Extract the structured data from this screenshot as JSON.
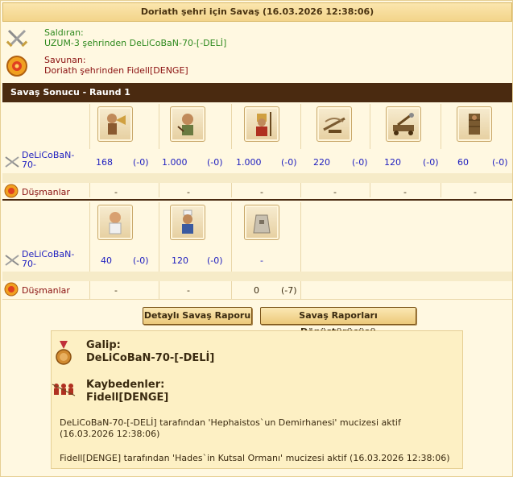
{
  "header": {
    "title": "Doriath şehri için Savaş (16.03.2026 12:38:06)"
  },
  "attacker": {
    "label": "Saldıran:",
    "value": "UZUM-3 şehrinden DeLiCoBaN-70-[-DELİ]",
    "icon": "crossed-swords-icon"
  },
  "defender": {
    "label": "Savunan:",
    "value": "Doriath şehrinden Fidell[DENGE]",
    "icon": "shield-icon"
  },
  "round_title": "Savaş Sonucu - Raund 1",
  "section1": {
    "attacker_name": "DeLiCoBaN-70-",
    "enemies_label": "Düşmanlar",
    "units": [
      {
        "icon": "trumpeter-icon",
        "count": "168",
        "delta": "(-0)",
        "enemy": "-",
        "enemy_delta": ""
      },
      {
        "icon": "slinger-icon",
        "count": "1.000",
        "delta": "(-0)",
        "enemy": "-",
        "enemy_delta": ""
      },
      {
        "icon": "hoplite-icon",
        "count": "1.000",
        "delta": "(-0)",
        "enemy": "-",
        "enemy_delta": ""
      },
      {
        "icon": "ballista-icon",
        "count": "220",
        "delta": "(-0)",
        "enemy": "-",
        "enemy_delta": ""
      },
      {
        "icon": "catapult-icon",
        "count": "120",
        "delta": "(-0)",
        "enemy": "-",
        "enemy_delta": ""
      },
      {
        "icon": "siege-tower-icon",
        "count": "60",
        "delta": "(-0)",
        "enemy": "-",
        "enemy_delta": ""
      }
    ]
  },
  "section2": {
    "attacker_name": "DeLiCoBaN-70-",
    "enemies_label": "Düşmanlar",
    "units": [
      {
        "icon": "doctor-icon",
        "count": "40",
        "delta": "(-0)",
        "enemy": "-",
        "enemy_delta": ""
      },
      {
        "icon": "cook-icon",
        "count": "120",
        "delta": "(-0)",
        "enemy": "-",
        "enemy_delta": ""
      },
      {
        "icon": "wall-icon",
        "count": "-",
        "delta": "",
        "enemy": "0",
        "enemy_delta": "(-7)"
      }
    ]
  },
  "buttons": {
    "detailed": "Detaylı Savaş Raporu",
    "converter": "Savaş Raporları Dönüştürücüsü"
  },
  "summary": {
    "winner_label": "Galip:",
    "winner": "DeLiCoBaN-70-[-DELİ]",
    "loser_label": "Kaybedenler:",
    "loser": "Fidell[DENGE]",
    "note1": "DeLiCoBaN-70-[-DELİ] tarafından 'Hephaistos`un Demirhanesi' mucizesi aktif (16.03.2026 12:38:06)",
    "note2": "Fidell[DENGE] tarafından 'Hades`in Kutsal Ormanı' mucizesi aktif (16.03.2026 12:38:06)"
  },
  "colors": {
    "dark_bar": "#4a2a10",
    "attacker_text": "#2f8a1f",
    "defender_text": "#8a1010",
    "unit_count": "#2020c0"
  }
}
